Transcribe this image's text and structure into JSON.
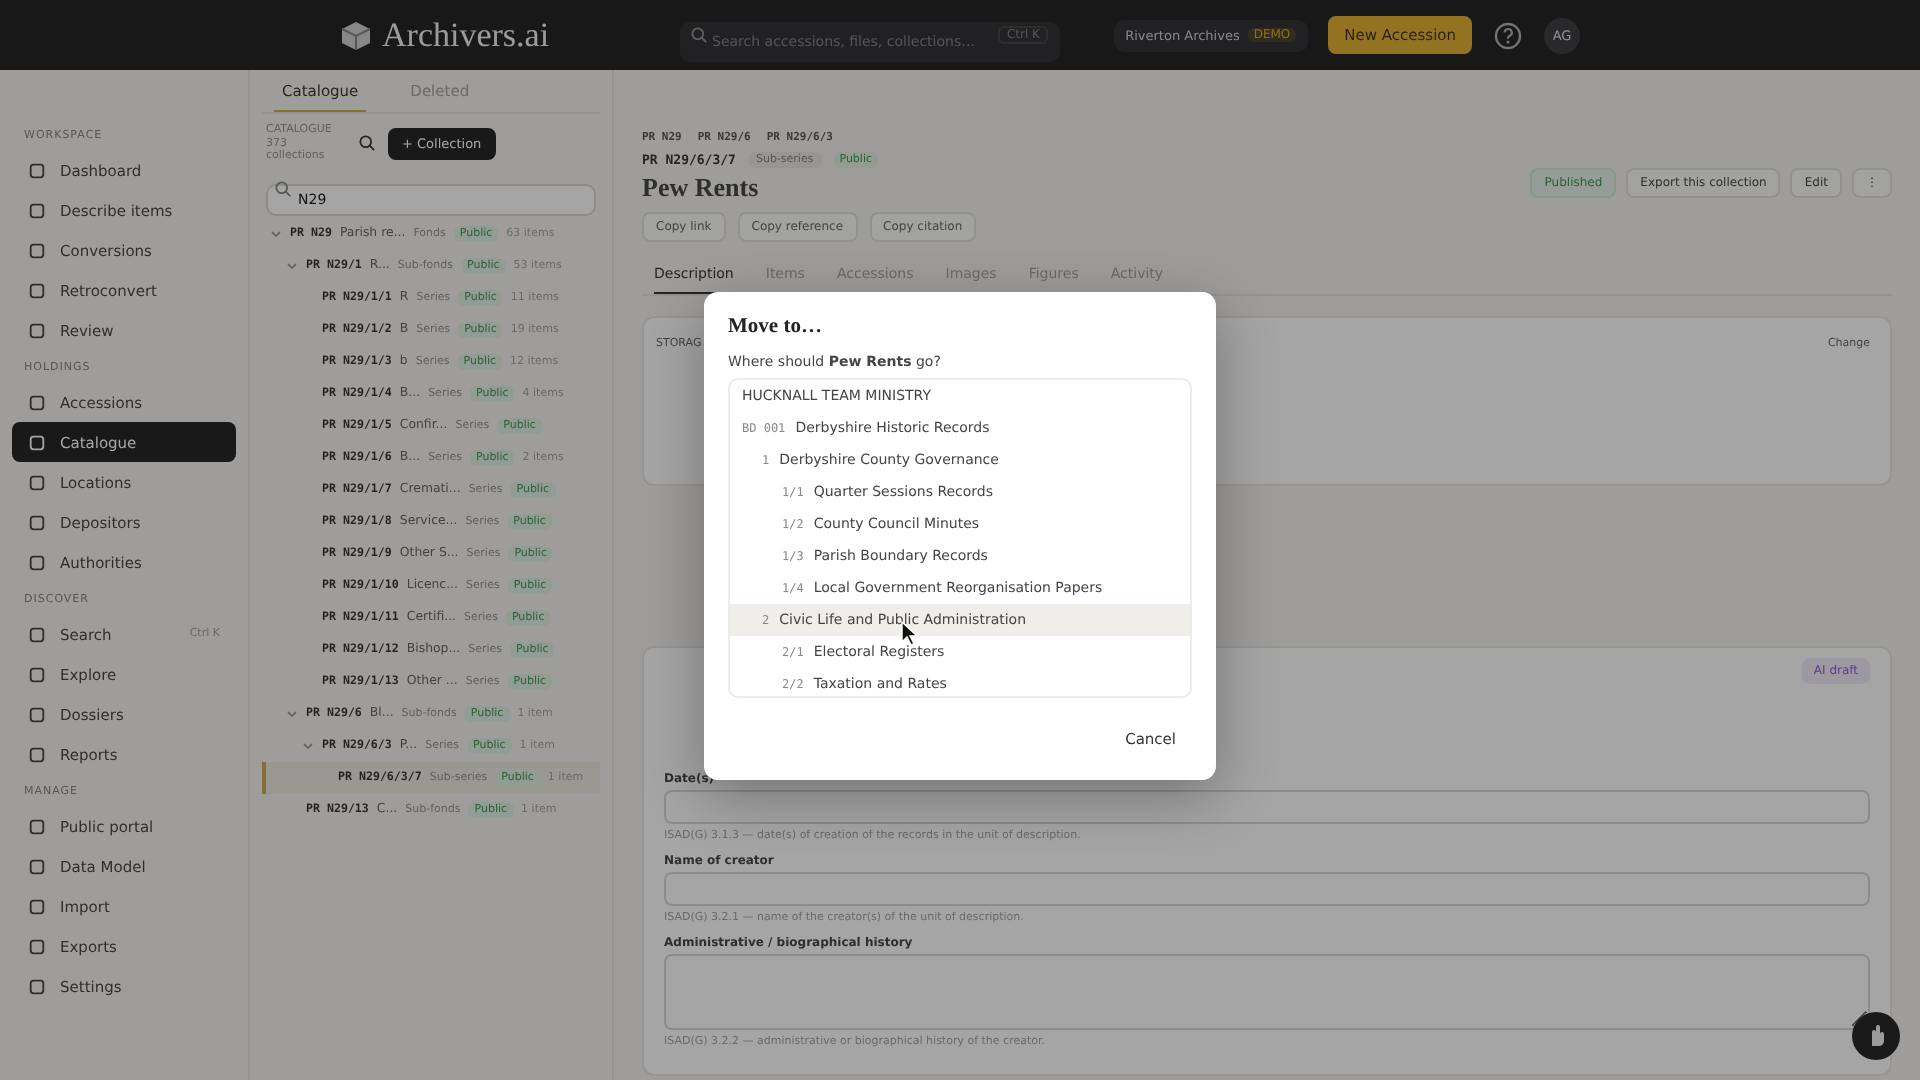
{
  "topbar": {
    "logo": "Archivers.ai",
    "search": {
      "placeholder": "Search accessions, files, collections…",
      "shortcut": "Ctrl K"
    },
    "org": {
      "name": "Riverton Archives",
      "badge": "DEMO"
    },
    "new_button": "New Accession",
    "avatar": "AG"
  },
  "sidebar": {
    "sections": [
      {
        "title": "WORKSPACE",
        "items": [
          {
            "label": "Dashboard",
            "selected": false
          },
          {
            "label": "Describe items",
            "selected": false
          },
          {
            "label": "Conversions",
            "selected": false
          },
          {
            "label": "Retroconvert",
            "selected": false
          },
          {
            "label": "Review",
            "selected": false
          }
        ]
      },
      {
        "title": "HOLDINGS",
        "items": [
          {
            "label": "Accessions",
            "selected": false
          },
          {
            "label": "Catalogue",
            "selected": true
          },
          {
            "label": "Locations",
            "selected": false
          },
          {
            "label": "Depositors",
            "selected": false
          },
          {
            "label": "Authorities",
            "selected": false
          }
        ]
      },
      {
        "title": "DISCOVER",
        "items": [
          {
            "label": "Search",
            "selected": false,
            "shortcut": "Ctrl K"
          },
          {
            "label": "Explore",
            "selected": false
          },
          {
            "label": "Dossiers",
            "selected": false
          },
          {
            "label": "Reports",
            "selected": false
          }
        ]
      },
      {
        "title": "MANAGE",
        "items": [
          {
            "label": "Public portal",
            "selected": false
          },
          {
            "label": "Data Model",
            "selected": false
          },
          {
            "label": "Import",
            "selected": false
          },
          {
            "label": "Exports",
            "selected": false
          },
          {
            "label": "Settings",
            "selected": false
          }
        ]
      }
    ]
  },
  "tree_panel": {
    "tabs": [
      {
        "label": "Catalogue",
        "selected": true
      },
      {
        "label": "Deleted",
        "selected": false
      }
    ],
    "caption": "CATALOGUE",
    "count": "373 collections",
    "add_button": "+ Collection",
    "search": {
      "value": "N29"
    },
    "tree": [
      {
        "ref": "PR N29",
        "title": "Parish re...",
        "level": "Fonds",
        "status": "Public",
        "count": "63 items",
        "expanded": true,
        "selected": false,
        "children": [
          {
            "ref": "PR N29/1",
            "title": "R...",
            "level": "Sub-fonds",
            "status": "Public",
            "count": "53 items",
            "expanded": true,
            "selected": false,
            "children": [
              {
                "ref": "PR N29/1/1",
                "title": "R",
                "level": "Series",
                "status": "Public",
                "count": "11 items",
                "selected": false
              },
              {
                "ref": "PR N29/1/2",
                "title": "B",
                "level": "Series",
                "status": "Public",
                "count": "19 items",
                "selected": false
              },
              {
                "ref": "PR N29/1/3",
                "title": "b",
                "level": "Series",
                "status": "Public",
                "count": "12 items",
                "selected": false
              },
              {
                "ref": "PR N29/1/4",
                "title": "B...",
                "level": "Series",
                "status": "Public",
                "count": "4 items",
                "selected": false
              },
              {
                "ref": "PR N29/1/5",
                "title": "Confir...",
                "level": "Series",
                "status": "Public",
                "selected": false
              },
              {
                "ref": "PR N29/1/6",
                "title": "B...",
                "level": "Series",
                "status": "Public",
                "count": "2 items",
                "selected": false
              },
              {
                "ref": "PR N29/1/7",
                "title": "Cremati...",
                "level": "Series",
                "status": "Public",
                "selected": false
              },
              {
                "ref": "PR N29/1/8",
                "title": "Service...",
                "level": "Series",
                "status": "Public",
                "selected": false
              },
              {
                "ref": "PR N29/1/9",
                "title": "Other S...",
                "level": "Series",
                "status": "Public",
                "selected": false
              },
              {
                "ref": "PR N29/1/10",
                "title": "Licenc...",
                "level": "Series",
                "status": "Public",
                "selected": false
              },
              {
                "ref": "PR N29/1/11",
                "title": "Certifi...",
                "level": "Series",
                "status": "Public",
                "selected": false
              },
              {
                "ref": "PR N29/1/12",
                "title": "Bishop...",
                "level": "Series",
                "status": "Public",
                "selected": false
              },
              {
                "ref": "PR N29/1/13",
                "title": "Other ...",
                "level": "Series",
                "status": "Public",
                "selected": false
              }
            ]
          },
          {
            "ref": "PR N29/6",
            "title": "Bl...",
            "level": "Sub-fonds",
            "status": "Public",
            "count": "1 item",
            "expanded": true,
            "selected": false,
            "children": [
              {
                "ref": "PR N29/6/3",
                "title": "P...",
                "level": "Series",
                "status": "Public",
                "count": "1 item",
                "expanded": true,
                "selected": false,
                "children": [
                  {
                    "ref": "PR N29/6/3/7",
                    "level": "Sub-series",
                    "status": "Public",
                    "count": "1 item",
                    "selected": true
                  }
                ]
              }
            ]
          },
          {
            "ref": "PR N29/13",
            "title": "C...",
            "level": "Sub-fonds",
            "status": "Public",
            "count": "1 item",
            "selected": false
          }
        ]
      }
    ]
  },
  "record": {
    "breadcrumb": [
      "PR N29",
      "PR N29/6",
      "PR N29/6/3"
    ],
    "ref": "PR N29/6/3/7",
    "level": "Sub-series",
    "status": "Public",
    "title": "Pew Rents",
    "header_buttons": [
      {
        "label": "Published",
        "kind": "status"
      },
      {
        "label": "Export this collection",
        "kind": "plain"
      },
      {
        "label": "Edit",
        "kind": "plain"
      },
      {
        "label": "⋮",
        "kind": "plain"
      }
    ],
    "copy_buttons": [
      "Copy link",
      "Copy reference",
      "Copy citation"
    ],
    "tabs": [
      {
        "label": "Description",
        "selected": true
      },
      {
        "label": "Items",
        "selected": false
      },
      {
        "label": "Accessions",
        "selected": false
      },
      {
        "label": "Images",
        "selected": false
      },
      {
        "label": "Figures",
        "selected": false
      },
      {
        "label": "Activity",
        "selected": false
      }
    ],
    "storage": {
      "caption": "STORAG",
      "action": "Change"
    },
    "isad": {
      "ai_button": "AI draft",
      "fields": [
        {
          "label": "Date(s)",
          "hint": "ISAD(G) 3.1.3 — date(s) of creation of the records in the unit of description.",
          "kind": "line"
        },
        {
          "label": "Name of creator",
          "hint": "ISAD(G) 3.2.1 — name of the creator(s) of the unit of description.",
          "kind": "line"
        },
        {
          "label": "Administrative / biographical history",
          "hint": "ISAD(G) 3.2.2 — administrative or biographical history of the creator.",
          "kind": "area"
        }
      ]
    }
  },
  "dialog": {
    "title": "Move to…",
    "prompt": "Where should **Pew Rents** go?",
    "cancel": "Cancel",
    "targets": [
      {
        "title": "HUCKNALL TEAM MINISTRY",
        "highlighted": false
      },
      {
        "ref": "BD 001",
        "title": "Derbyshire Historic Records",
        "highlighted": false,
        "children": [
          {
            "ref": "1",
            "title": "Derbyshire County Governance",
            "highlighted": false,
            "children": [
              {
                "ref": "1/1",
                "title": "Quarter Sessions Records",
                "highlighted": false
              },
              {
                "ref": "1/2",
                "title": "County Council Minutes",
                "highlighted": false
              },
              {
                "ref": "1/3",
                "title": "Parish Boundary Records",
                "highlighted": false
              },
              {
                "ref": "1/4",
                "title": "Local Government Reorganisation Papers",
                "highlighted": false
              }
            ]
          },
          {
            "ref": "2",
            "title": "Civic Life and Public Administration",
            "highlighted": true,
            "children": [
              {
                "ref": "2/1",
                "title": "Electoral Registers",
                "highlighted": false
              },
              {
                "ref": "2/2",
                "title": "Taxation and Rates",
                "highlighted": false
              }
            ]
          }
        ]
      }
    ]
  }
}
